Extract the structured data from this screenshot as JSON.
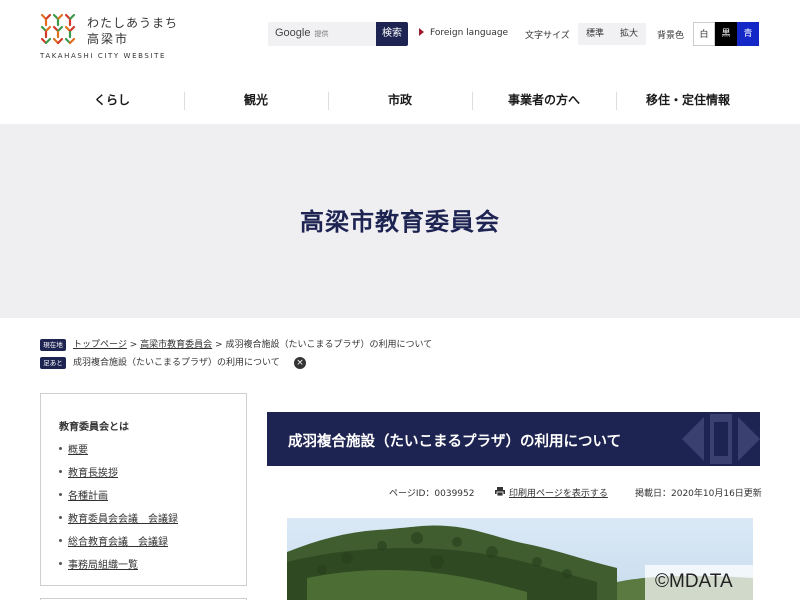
{
  "header": {
    "logo": {
      "line1": "わたしあうまち",
      "line2": "高梁市",
      "english": "TAKAHASHI CITY WEBSITE"
    },
    "search": {
      "brand": "Google",
      "brand_note": "提供",
      "button_label": "検索"
    },
    "foreign_language": "Foreign language",
    "font_size": {
      "label": "文字サイズ",
      "options": [
        "標準",
        "拡大"
      ]
    },
    "background_color": {
      "label": "背景色",
      "options": [
        "白",
        "黒",
        "青"
      ]
    }
  },
  "global_nav": {
    "items": [
      "くらし",
      "観光",
      "市政",
      "事業者の方へ",
      "移住・定住情報"
    ]
  },
  "hero": {
    "title": "高梁市教育委員会"
  },
  "breadcrumbs": {
    "current_tag": "現在地",
    "trail": [
      "トップページ",
      "高梁市教育委員会"
    ],
    "separator": ">",
    "current": "成羽複合施設（たいこまるプラザ）の利用について",
    "history_tag": "足あと",
    "history_item": "成羽複合施設（たいこまるプラザ）の利用について"
  },
  "sidebar": {
    "title": "教育委員会とは",
    "items": [
      "概要",
      "教育長挨拶",
      "各種計画",
      "教育委員会会議　会議録",
      "総合教育会議　会議録",
      "事務局組織一覧"
    ]
  },
  "main": {
    "title": "成羽複合施設（たいこまるプラザ）の利用について",
    "page_id": "ページID：0039952",
    "print_label": "印刷用ページを表示する",
    "posted": "掲載日：2020年10月16日更新"
  },
  "watermark": "©MDATA",
  "colors": {
    "navy": "#1e2452",
    "hero_bg": "#efeff2",
    "accent_red": "#9c1c2e",
    "bg_blue": "#1428c8"
  }
}
